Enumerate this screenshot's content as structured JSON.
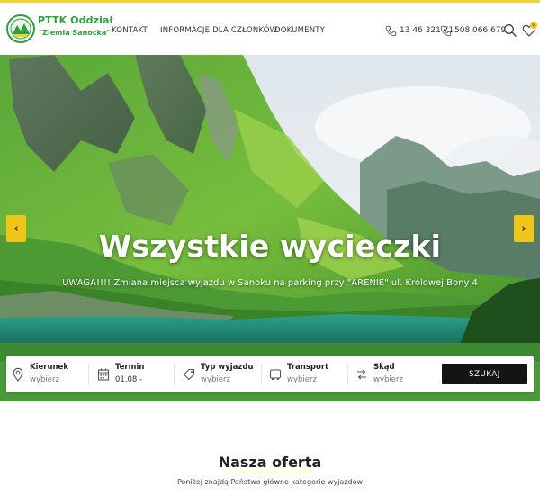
{
  "brand": {
    "name": "PTTK Oddział",
    "subtitle": "\"Ziemia Sanocka\""
  },
  "nav": {
    "items": [
      "KONTAKT",
      "INFORMACJE DLA CZŁONKÓW",
      "DOKUMENTY"
    ]
  },
  "contacts": {
    "phone1": "13 46 321 71",
    "phone2": "508 066 679"
  },
  "header_icons": {
    "search": "search-icon",
    "wishlist": "heart-icon",
    "wishlist_count": "0"
  },
  "hero": {
    "title": "Wszystkie wycieczki",
    "subtitle": "UWAGA!!!! Zmiana miejsca wyjazdu w Sanoku na parking przy \"ARENIE\" ul. Królowej Bony 4",
    "prev_arrow": "‹",
    "next_arrow": "›"
  },
  "search": {
    "fields": [
      {
        "label": "Kierunek",
        "value": "wybierz",
        "icon": "map-pin-icon"
      },
      {
        "label": "Termin",
        "value": "01.08 -",
        "icon": "calendar-icon"
      },
      {
        "label": "Typ wyjazdu",
        "value": "wybierz",
        "icon": "tag-icon"
      },
      {
        "label": "Transport",
        "value": "wybierz",
        "icon": "bus-icon"
      },
      {
        "label": "Skąd",
        "value": "wybierz",
        "icon": "route-icon"
      }
    ],
    "button": "SZUKAJ"
  },
  "offer": {
    "title": "Nasza oferta",
    "subtitle": "Poniżej znajdą Państwo główne kategorie wyjazdów"
  },
  "colors": {
    "accent": "#f2d230",
    "brand_green": "#2f9e3b",
    "button_dark": "#141414"
  }
}
